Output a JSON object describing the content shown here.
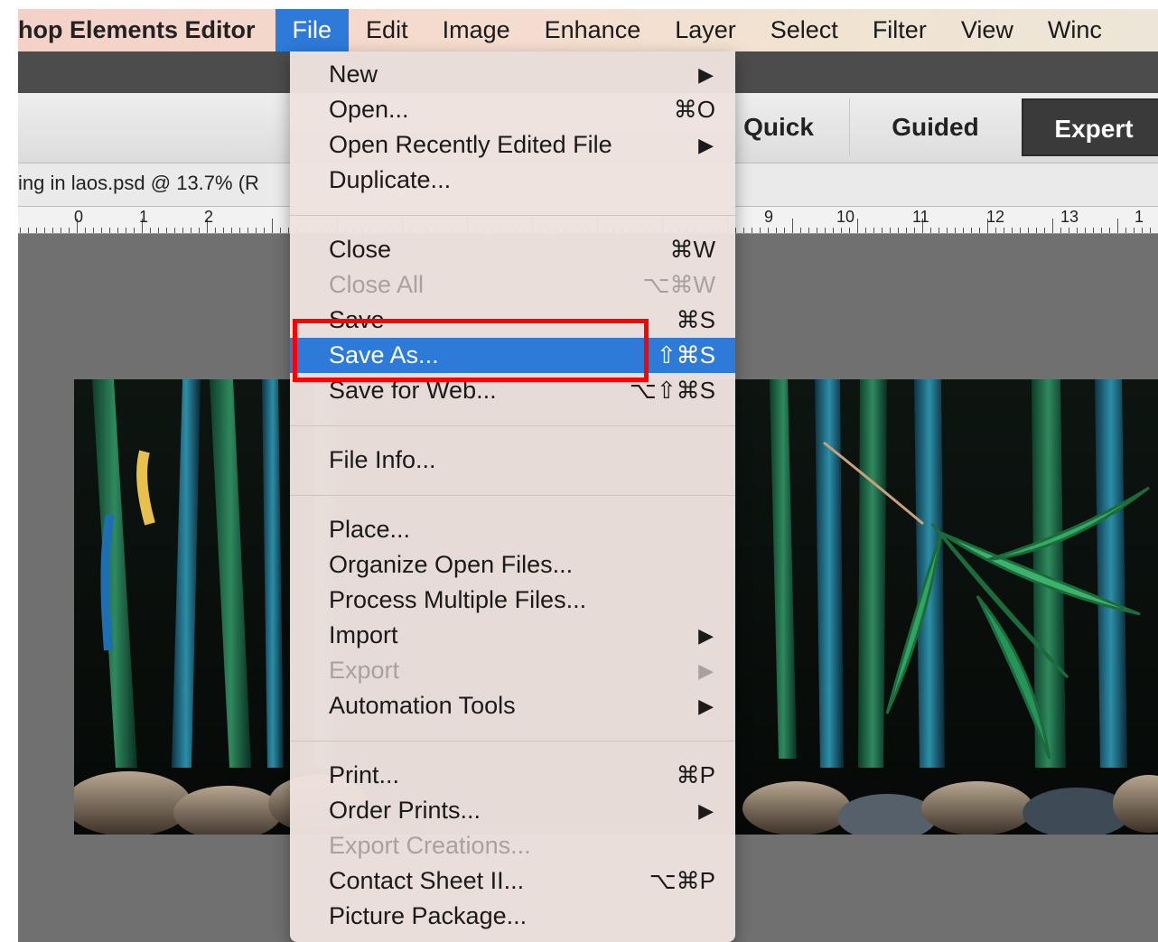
{
  "menubar": {
    "app_name": "hop Elements Editor",
    "items": [
      "File",
      "Edit",
      "Image",
      "Enhance",
      "Layer",
      "Select",
      "Filter",
      "View",
      "Winc"
    ],
    "active": "File"
  },
  "modes": {
    "quick": "Quick",
    "guided": "Guided",
    "expert": "Expert"
  },
  "document": {
    "title": "ing in laos.psd @ 13.7% (R"
  },
  "ruler": {
    "labels": [
      "0",
      "1",
      "2",
      "9",
      "10",
      "11",
      "12",
      "13",
      "1"
    ]
  },
  "file_menu": {
    "new": "New",
    "open": "Open...",
    "open_shortcut": "⌘O",
    "open_recent": "Open Recently Edited File",
    "duplicate": "Duplicate...",
    "close": "Close",
    "close_shortcut": "⌘W",
    "close_all": "Close All",
    "close_all_shortcut": "⌥⌘W",
    "save": "Save",
    "save_shortcut": "⌘S",
    "save_as": "Save As...",
    "save_as_shortcut": "⇧⌘S",
    "save_web": "Save for Web...",
    "save_web_shortcut": "⌥⇧⌘S",
    "file_info": "File Info...",
    "place": "Place...",
    "organize": "Organize Open Files...",
    "process": "Process Multiple Files...",
    "import": "Import",
    "export": "Export",
    "automation": "Automation Tools",
    "print": "Print...",
    "print_shortcut": "⌘P",
    "order_prints": "Order Prints...",
    "export_creations": "Export Creations...",
    "contact_sheet": "Contact Sheet II...",
    "contact_sheet_shortcut": "⌥⌘P",
    "picture_package": "Picture Package...",
    "submenu_arrow": "▶"
  },
  "colors": {
    "accent": "#2d7ad8",
    "highlight_box": "#ff0000"
  }
}
